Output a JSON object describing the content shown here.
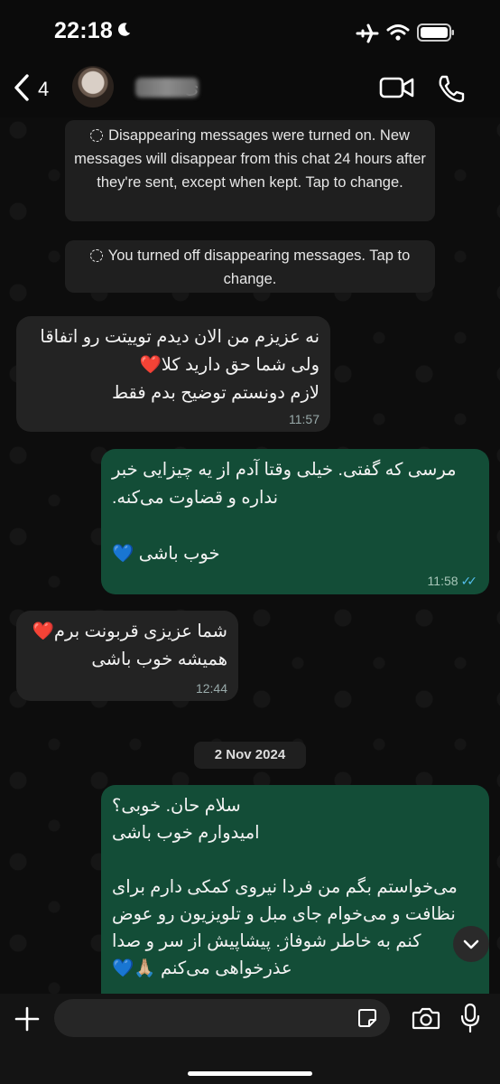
{
  "status_bar": {
    "time": "22:18"
  },
  "header": {
    "back_count": "4",
    "contact_name": "ی"
  },
  "notices": [
    "Disappearing messages were turned on. New messages will disappear from this chat 24 hours after they're sent, except when kept. Tap to change.",
    "You turned off disappearing messages. Tap to change."
  ],
  "messages": [
    {
      "direction": "incoming",
      "text": "نه عزیزم من الان دیدم توییتت رو اتفاقا\nولی شما حق دارید کلا❤️\nلازم دونستم توضیح بدم فقط",
      "time": "11:57"
    },
    {
      "direction": "outgoing",
      "text": "مرسی که گفتی. خیلی وقتا آدم از یه چیزایی خبر\nنداره و قضاوت می‌کنه.\n\nخوب باشی 💙",
      "time": "11:58",
      "read": true
    },
    {
      "direction": "incoming",
      "text": "شما عزیزی قربونت برم❤️\nهمیشه خوب باشی",
      "time": "12:44"
    },
    {
      "direction": "outgoing",
      "text": "سلام حان. خوبی؟\nامیدوارم خوب باشی\n\nمی‌خواستم بگم من فردا نیروی کمکی دارم برای\nنظافت و می‌خوام جای مبل و تلویزیون رو عوض\nکنم به خاطر شوفاژ. پیشاپیش از سر و صدا\nعذرخواهی می‌کنم 🙏🏼💙",
      "time": ""
    }
  ],
  "date_divider": "2 Nov 2024",
  "composer": {
    "placeholder": ""
  },
  "colors": {
    "incoming_bubble": "#232323",
    "outgoing_bubble": "#134d37",
    "read_ticks": "#53bdeb"
  }
}
